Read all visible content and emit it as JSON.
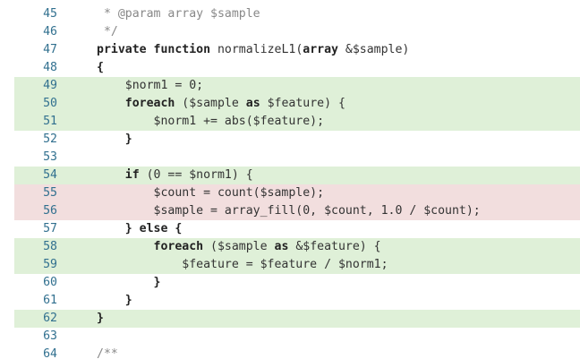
{
  "lines": [
    {
      "number": "45",
      "status": "context",
      "tokens": [
        {
          "t": " * @param array $sample",
          "k": "comment"
        }
      ]
    },
    {
      "number": "46",
      "status": "context",
      "tokens": [
        {
          "t": " */",
          "k": "comment"
        }
      ]
    },
    {
      "number": "47",
      "status": "context",
      "tokens": [
        {
          "t": "private function",
          "k": "kw"
        },
        {
          "t": " normalizeL1(",
          "k": "plain"
        },
        {
          "t": "array",
          "k": "kw"
        },
        {
          "t": " &$sample)",
          "k": "plain"
        }
      ]
    },
    {
      "number": "48",
      "status": "context",
      "tokens": [
        {
          "t": "{",
          "k": "kw"
        }
      ]
    },
    {
      "number": "49",
      "status": "added",
      "tokens": [
        {
          "t": "    $norm1 = 0;",
          "k": "plain"
        }
      ]
    },
    {
      "number": "50",
      "status": "added",
      "tokens": [
        {
          "t": "    ",
          "k": "plain"
        },
        {
          "t": "foreach",
          "k": "kw"
        },
        {
          "t": " ($sample ",
          "k": "plain"
        },
        {
          "t": "as",
          "k": "kw"
        },
        {
          "t": " $feature) {",
          "k": "plain"
        }
      ]
    },
    {
      "number": "51",
      "status": "added",
      "tokens": [
        {
          "t": "        $norm1 += abs($feature);",
          "k": "plain"
        }
      ]
    },
    {
      "number": "52",
      "status": "context",
      "tokens": [
        {
          "t": "    ",
          "k": "plain"
        },
        {
          "t": "}",
          "k": "kw"
        }
      ]
    },
    {
      "number": "53",
      "status": "context",
      "tokens": []
    },
    {
      "number": "54",
      "status": "added",
      "tokens": [
        {
          "t": "    ",
          "k": "plain"
        },
        {
          "t": "if",
          "k": "kw"
        },
        {
          "t": " (0 == $norm1) {",
          "k": "plain"
        }
      ]
    },
    {
      "number": "55",
      "status": "removed",
      "tokens": [
        {
          "t": "        $count = count($sample);",
          "k": "plain"
        }
      ]
    },
    {
      "number": "56",
      "status": "removed",
      "tokens": [
        {
          "t": "        $sample = array_fill(0, $count, 1.0 / $count);",
          "k": "plain"
        }
      ]
    },
    {
      "number": "57",
      "status": "context",
      "tokens": [
        {
          "t": "    ",
          "k": "plain"
        },
        {
          "t": "} else {",
          "k": "kw"
        }
      ]
    },
    {
      "number": "58",
      "status": "added",
      "tokens": [
        {
          "t": "        ",
          "k": "plain"
        },
        {
          "t": "foreach",
          "k": "kw"
        },
        {
          "t": " ($sample ",
          "k": "plain"
        },
        {
          "t": "as",
          "k": "kw"
        },
        {
          "t": " &$feature) {",
          "k": "plain"
        }
      ]
    },
    {
      "number": "59",
      "status": "added",
      "tokens": [
        {
          "t": "            $feature = $feature / $norm1;",
          "k": "plain"
        }
      ]
    },
    {
      "number": "60",
      "status": "context",
      "tokens": [
        {
          "t": "        ",
          "k": "plain"
        },
        {
          "t": "}",
          "k": "kw"
        }
      ]
    },
    {
      "number": "61",
      "status": "context",
      "tokens": [
        {
          "t": "    ",
          "k": "plain"
        },
        {
          "t": "}",
          "k": "kw"
        }
      ]
    },
    {
      "number": "62",
      "status": "added",
      "tokens": [
        {
          "t": "}",
          "k": "kw"
        }
      ]
    },
    {
      "number": "63",
      "status": "context",
      "tokens": []
    },
    {
      "number": "64",
      "status": "context",
      "tokens": [
        {
          "t": "/**",
          "k": "comment"
        }
      ]
    }
  ],
  "colors": {
    "added_background": "#dff0d8",
    "removed_background": "#f2dede",
    "line_number": "#31708f",
    "code_text": "#333333",
    "comment_text": "#888888"
  }
}
